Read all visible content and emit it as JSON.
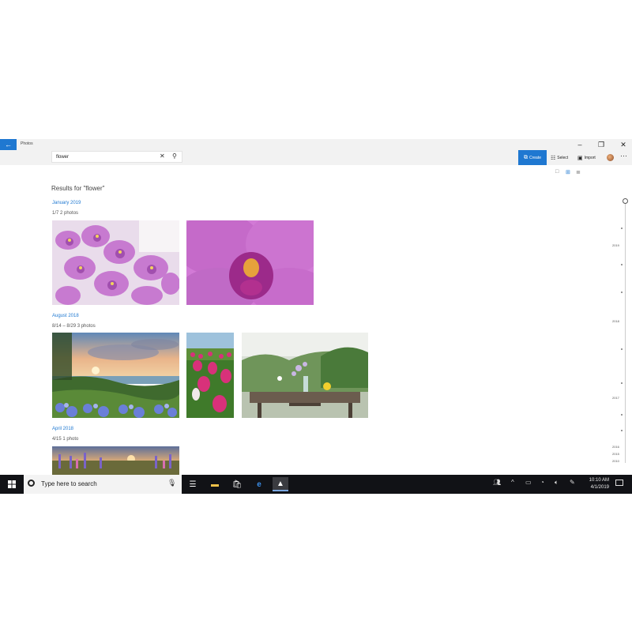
{
  "titlebar": {
    "app_title": "Photos",
    "back_icon": "arrow-left-icon"
  },
  "toolbar": {
    "search_value": "flower",
    "create_label": "Create",
    "select_label": "Select",
    "import_label": "Import"
  },
  "results": {
    "title": "Results for \"flower\"",
    "groups": [
      {
        "month": "January 2019",
        "range": "1/7    2 photos"
      },
      {
        "month": "August 2018",
        "range": "8/14 – 8/29    3 photos"
      },
      {
        "month": "April 2018",
        "range": "4/15    1 photo"
      }
    ]
  },
  "timeline": {
    "years": [
      "2019",
      "2018",
      "2017",
      "2016",
      "2015",
      "2010"
    ]
  },
  "taskbar": {
    "search_placeholder": "Type here to search",
    "time": "10:10 AM",
    "date": "4/1/2019"
  },
  "colors": {
    "accent": "#1f78d1",
    "taskbar": "#111216"
  }
}
